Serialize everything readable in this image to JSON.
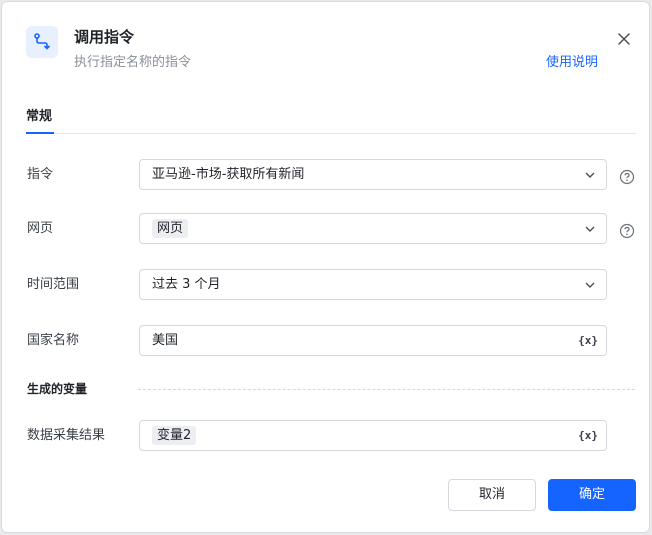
{
  "dialog": {
    "title": "调用指令",
    "subtitle": "执行指定名称的指令",
    "help_link": "使用说明",
    "icon": "route-icon",
    "close_icon": "close-icon"
  },
  "tabs": [
    {
      "label": "常规",
      "active": true
    }
  ],
  "fields": {
    "command": {
      "label": "指令",
      "value": "亚马逊-市场-获取所有新闻"
    },
    "webpage": {
      "label": "网页",
      "value": "网页"
    },
    "time_range": {
      "label": "时间范围",
      "value": "过去 3 个月"
    },
    "country": {
      "label": "国家名称",
      "value": "美国",
      "var_button": "{x}"
    }
  },
  "output_section": {
    "title": "生成的变量",
    "result": {
      "label": "数据采集结果",
      "value": "变量2",
      "var_button": "{x}"
    }
  },
  "buttons": {
    "cancel": "取消",
    "ok": "确定"
  },
  "colors": {
    "accent": "#1664ff",
    "chip_bg": "#eceef1",
    "border": "#d5d8dd"
  }
}
